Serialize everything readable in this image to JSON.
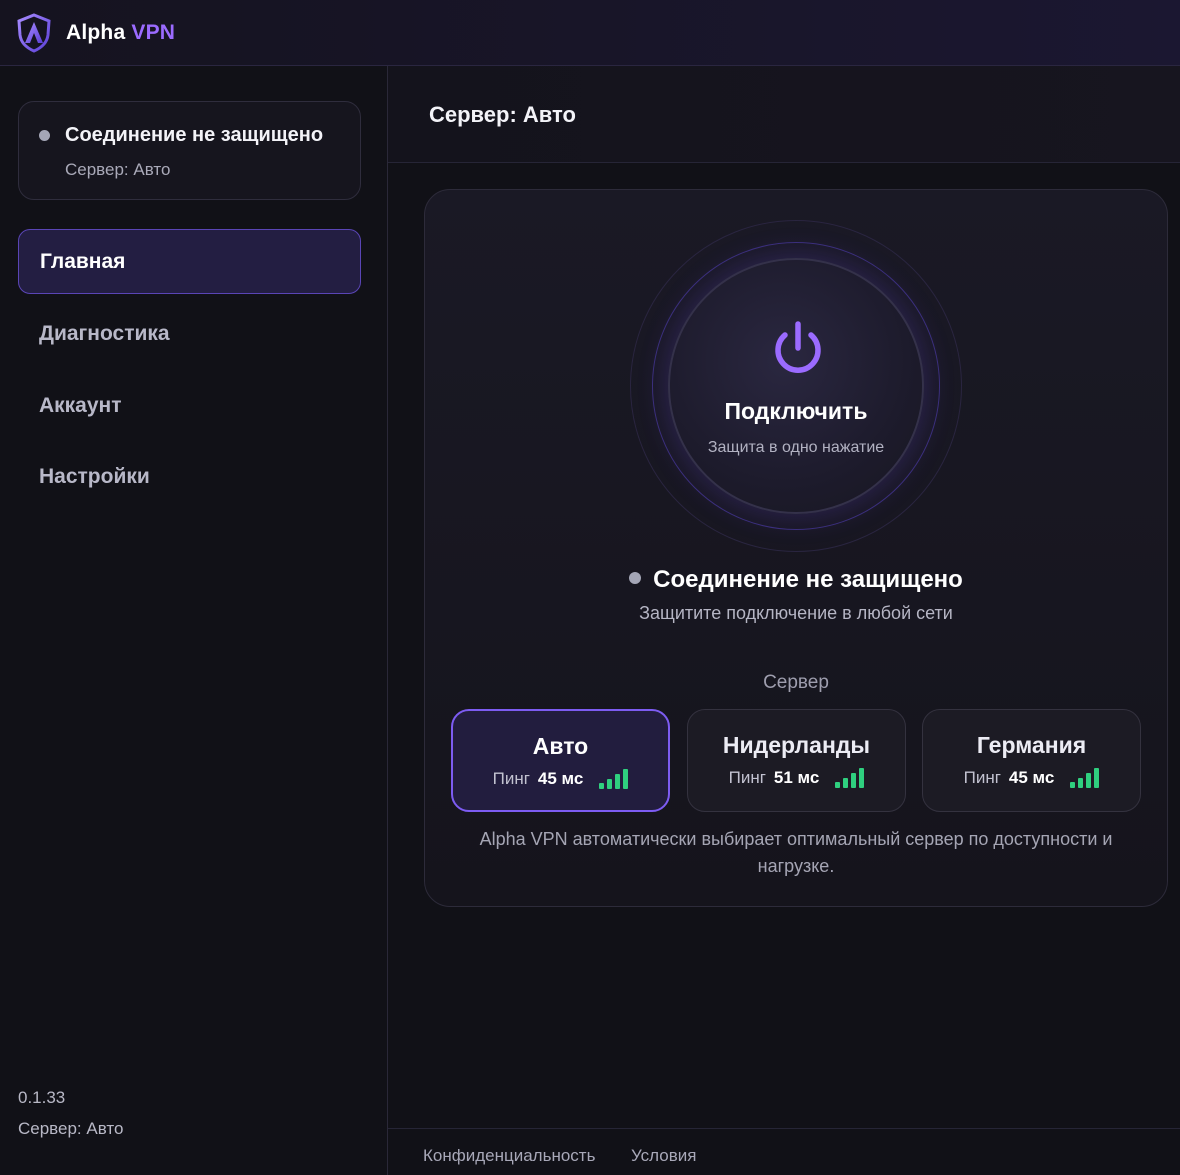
{
  "titlebar": {
    "app_name": "Alpha",
    "app_name_accent": "VPN",
    "logo_icon": "shield-logo-icon"
  },
  "sidebar": {
    "status": {
      "title": "Соединение не защищено",
      "subtitle": "Сервер: Авто"
    },
    "nav": [
      {
        "label": "Главная",
        "active": true
      },
      {
        "label": "Диагностика",
        "active": false
      },
      {
        "label": "Аккаунт",
        "active": false
      },
      {
        "label": "Настройки",
        "active": false
      }
    ],
    "version": "0.1.33",
    "server": "Сервер: Авто"
  },
  "main": {
    "title": "Сервер: Авто",
    "connect": {
      "label": "Подключить",
      "subtitle": "Защита в одно нажатие",
      "icon": "power-icon"
    },
    "status_title": "Соединение не защищено",
    "status_hint": "Защитите подключение в любой сети",
    "server_label": "Сервер",
    "servers": [
      {
        "name": "Авто",
        "ping_label": "Пинг",
        "ping_value": "45 мс",
        "active": true
      },
      {
        "name": "Нидерланды",
        "ping_label": "Пинг",
        "ping_value": "51 мс",
        "active": false
      },
      {
        "name": "Германия",
        "ping_label": "Пинг",
        "ping_value": "45 мс",
        "active": false
      }
    ],
    "server_note": "Alpha VPN автоматически выбирает оптимальный сервер по доступности и нагрузке."
  },
  "footer": {
    "privacy": "Конфиденциальность",
    "terms": "Условия"
  },
  "colors": {
    "accent": "#9b6bff",
    "signal": "#2fd07f",
    "background": "#111117"
  }
}
